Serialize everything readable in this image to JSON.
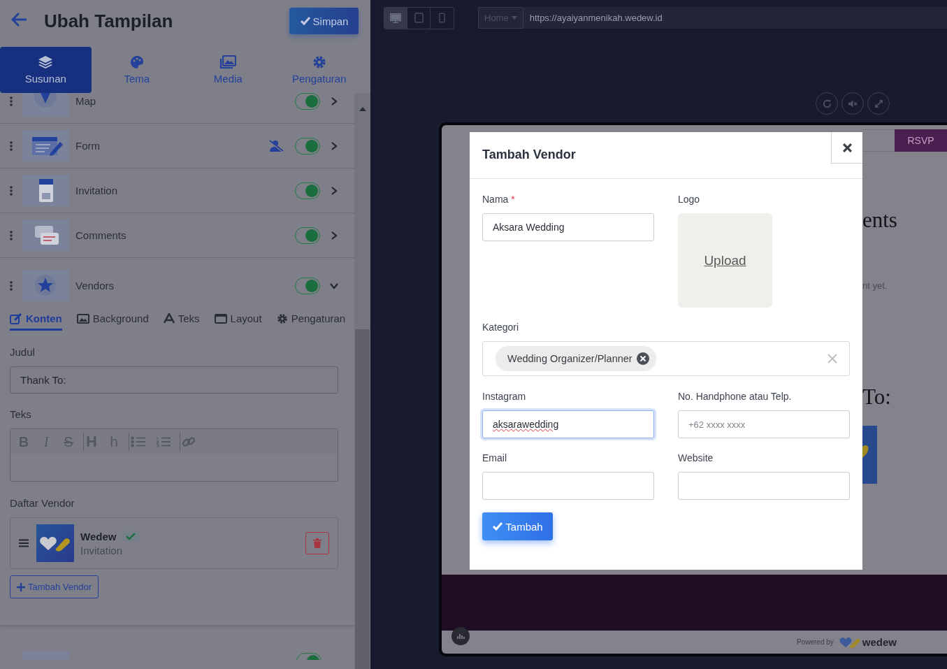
{
  "header": {
    "title": "Ubah Tampilan",
    "save_button": "Simpan"
  },
  "main_tabs": [
    {
      "label": "Susunan",
      "selected": true
    },
    {
      "label": "Tema",
      "selected": false
    },
    {
      "label": "Media",
      "selected": false
    },
    {
      "label": "Pengaturan",
      "selected": false
    }
  ],
  "sections": [
    {
      "name": "Map",
      "enabled": true,
      "expanded": false,
      "guest_hidden": false
    },
    {
      "name": "Form",
      "enabled": true,
      "expanded": false,
      "guest_hidden": true
    },
    {
      "name": "Invitation",
      "enabled": true,
      "expanded": false,
      "guest_hidden": false
    },
    {
      "name": "Comments",
      "enabled": true,
      "expanded": false,
      "guest_hidden": false
    },
    {
      "name": "Vendors",
      "enabled": true,
      "expanded": true,
      "guest_hidden": false
    }
  ],
  "vendors_panel": {
    "sub_tabs": [
      {
        "label": "Konten",
        "selected": true
      },
      {
        "label": "Background",
        "selected": false
      },
      {
        "label": "Teks",
        "selected": false
      },
      {
        "label": "Layout",
        "selected": false
      },
      {
        "label": "Pengaturan",
        "selected": false
      }
    ],
    "title_label": "Judul",
    "title_value": "Thank To:",
    "text_label": "Teks",
    "editor_toolbar": [
      [
        {
          "kind": "bold",
          "label": "B"
        },
        {
          "kind": "italic",
          "label": "I"
        },
        {
          "kind": "strike",
          "label": "S"
        }
      ],
      [
        {
          "kind": "heading",
          "label": "H"
        },
        {
          "kind": "subheading",
          "label": "h"
        }
      ],
      [
        {
          "kind": "bullet"
        },
        {
          "kind": "numbered"
        }
      ],
      [
        {
          "kind": "link"
        }
      ]
    ],
    "list_label": "Daftar Vendor",
    "vendors": [
      {
        "name": "Wedew",
        "category": "Invitation",
        "verified": true
      }
    ],
    "add_button": "Tambah Vendor"
  },
  "trailing_row": {
    "enabled": true
  },
  "preview": {
    "devices": [
      {
        "selected": true
      },
      {
        "selected": false
      },
      {
        "selected": false
      }
    ],
    "page_select": "Home",
    "url": "https://ayaiyanmenikah.wedew.id",
    "site": {
      "rsvp": "RSVP",
      "heading": "ents",
      "note": "nt yet.",
      "title": "To:",
      "powered_by": "Powered by",
      "brand": "wedew"
    }
  },
  "modal": {
    "title": "Tambah Vendor",
    "name_field": {
      "label": "Nama",
      "required_mark": "*",
      "value": "Aksara Wedding"
    },
    "logo_field": {
      "label": "Logo",
      "upload": "Upload"
    },
    "category_field": {
      "label": "Kategori",
      "chips": [
        "Wedding Organizer/Planner"
      ]
    },
    "instagram_field": {
      "label": "Instagram",
      "value": "aksarawedding",
      "focused": true
    },
    "phone_field": {
      "label": "No. Handphone atau Telp.",
      "placeholder": "+62 xxxx xxxx"
    },
    "email_field": {
      "label": "Email"
    },
    "website_field": {
      "label": "Website"
    },
    "submit": "Tambah"
  }
}
